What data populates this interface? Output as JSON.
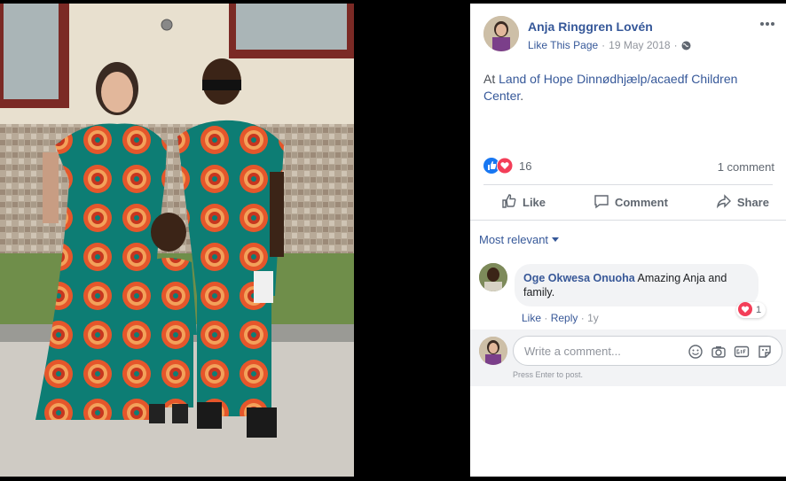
{
  "post": {
    "author": "Anja Ringgren Lovén",
    "like_page": "Like This Page",
    "separator": "·",
    "date": "19 May 2018",
    "text_prefix": "At ",
    "location": "Land of Hope Dinnødhjælp/acaedf Children Center",
    "text_suffix": "."
  },
  "reactions": {
    "count": "16",
    "comments_label": "1 comment"
  },
  "actions": {
    "like": "Like",
    "comment": "Comment",
    "share": "Share"
  },
  "filter": {
    "label": "Most relevant"
  },
  "comment": {
    "name": "Oge Okwesa Onuoha",
    "text": " Amazing Anja and family.",
    "reaction_count": "1",
    "like": "Like",
    "reply": "Reply",
    "dot": "·",
    "age": "1y"
  },
  "composer": {
    "placeholder": "Write a comment...",
    "hint": "Press Enter to post."
  },
  "colors": {
    "link": "#365899",
    "like_blue": "#1877f2",
    "heart_red": "#f33e58",
    "fabric_teal": "#0d7d74",
    "fabric_orange": "#e5562b"
  },
  "icons": [
    "more-icon",
    "globe-icon",
    "like-reaction-icon",
    "love-reaction-icon",
    "thumbs-up-icon",
    "comment-icon",
    "share-icon",
    "emoji-icon",
    "camera-icon",
    "gif-icon",
    "sticker-icon"
  ]
}
